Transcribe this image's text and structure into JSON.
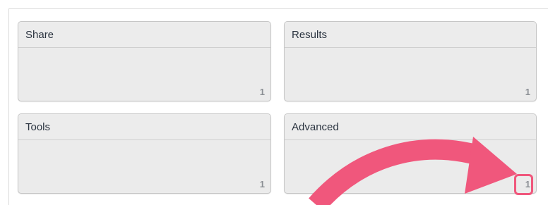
{
  "cards": [
    {
      "title": "Share",
      "count": "1"
    },
    {
      "title": "Results",
      "count": "1"
    },
    {
      "title": "Tools",
      "count": "1"
    },
    {
      "title": "Advanced",
      "count": "1"
    }
  ],
  "annotation": {
    "arrow_icon": "curved-arrow-icon",
    "color": "#f0577c"
  }
}
